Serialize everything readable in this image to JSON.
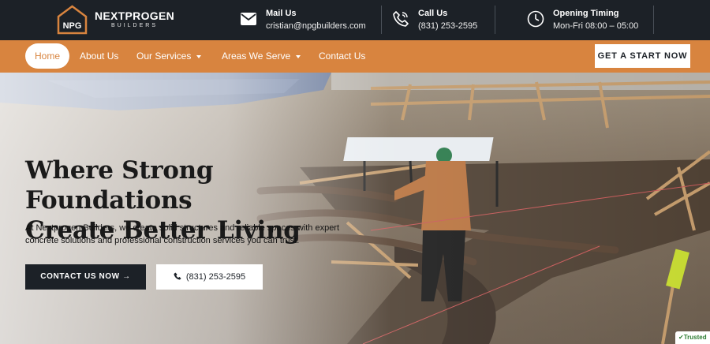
{
  "brand": {
    "monogram": "NPG",
    "name": "NEXTPROGEN",
    "tagline": "BUILDERS"
  },
  "contacts": [
    {
      "title": "Mail Us",
      "value": "cristian@npgbuilders.com",
      "icon": "mail-icon"
    },
    {
      "title": "Call Us",
      "value": "(831) 253-2595",
      "icon": "phone-icon"
    },
    {
      "title": "Opening Timing",
      "value": "Mon-Fri 08:00 – 05:00",
      "icon": "clock-icon"
    }
  ],
  "nav": {
    "home": "Home",
    "about": "About Us",
    "services": "Our Services",
    "areas": "Areas We Serve",
    "contact": "Contact Us",
    "cta": "GET A START NOW"
  },
  "hero": {
    "title_line1": "Where Strong Foundations",
    "title_line2": "Create Better Living",
    "description": "At Nextprogen Builders, we create solid structures and reliable spaces with expert concrete solutions and professional construction services you can trust.",
    "btn_contact": "CONTACT US NOW →",
    "btn_phone": "(831) 253-2595"
  },
  "badge": {
    "trusted": "Trusted"
  },
  "colors": {
    "dark": "#1c2127",
    "accent": "#d8843f",
    "white": "#ffffff"
  }
}
